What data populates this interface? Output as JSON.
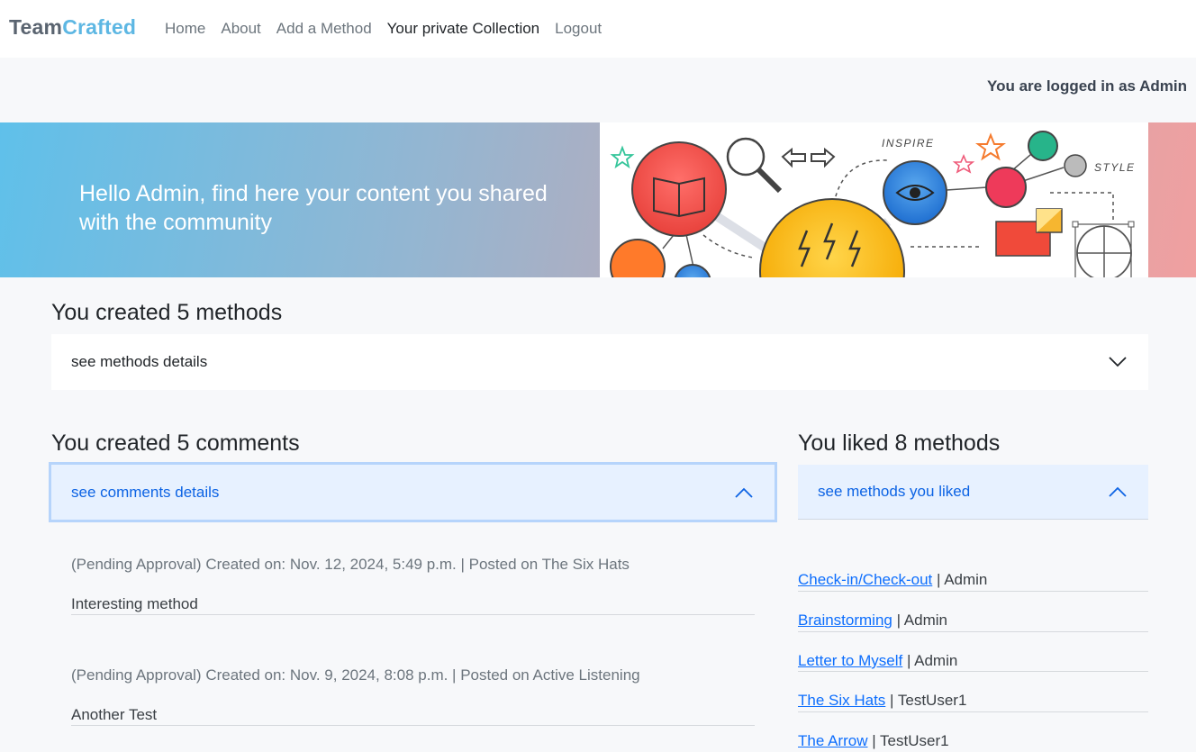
{
  "brand": {
    "part1": "Team",
    "part2": "Crafted"
  },
  "nav": {
    "items": [
      "Home",
      "About",
      "Add a Method",
      "Your private Collection",
      "Logout"
    ]
  },
  "user": {
    "logged_in_text": "You are logged in as Admin"
  },
  "hero": {
    "greeting": "Hello Admin, find here your content you shared with the community",
    "illustration_words": [
      "INSPIRE",
      "STYLE"
    ]
  },
  "methods_section": {
    "title": "You created 5 methods",
    "accordion_label": "see methods details"
  },
  "comments_section": {
    "title": "You created 5 comments",
    "accordion_label": "see comments details",
    "comments": [
      {
        "meta": "(Pending Approval) Created on: Nov. 12, 2024, 5:49 p.m. | Posted on The Six Hats",
        "body": "Interesting method"
      },
      {
        "meta": "(Pending Approval) Created on: Nov. 9, 2024, 8:08 p.m. | Posted on Active Listening",
        "body": "Another Test"
      }
    ]
  },
  "liked_section": {
    "title": "You liked 8 methods",
    "accordion_label": "see methods you liked",
    "items": [
      {
        "method": "Check-in/Check-out",
        "author": " | Admin"
      },
      {
        "method": "Brainstorming",
        "author": " | Admin"
      },
      {
        "method": "Letter to Myself",
        "author": " | Admin"
      },
      {
        "method": "The Six Hats",
        "author": " | TestUser1"
      },
      {
        "method": "The Arrow",
        "author": " | TestUser1"
      }
    ]
  },
  "colors": {
    "brand_gray": "#5a6470",
    "brand_blue": "#5db7e3",
    "link_blue": "#0d6efd",
    "open_accordion_bg": "#e7f1ff"
  },
  "icons": [
    "chevron-down-icon",
    "chevron-up-icon"
  ]
}
